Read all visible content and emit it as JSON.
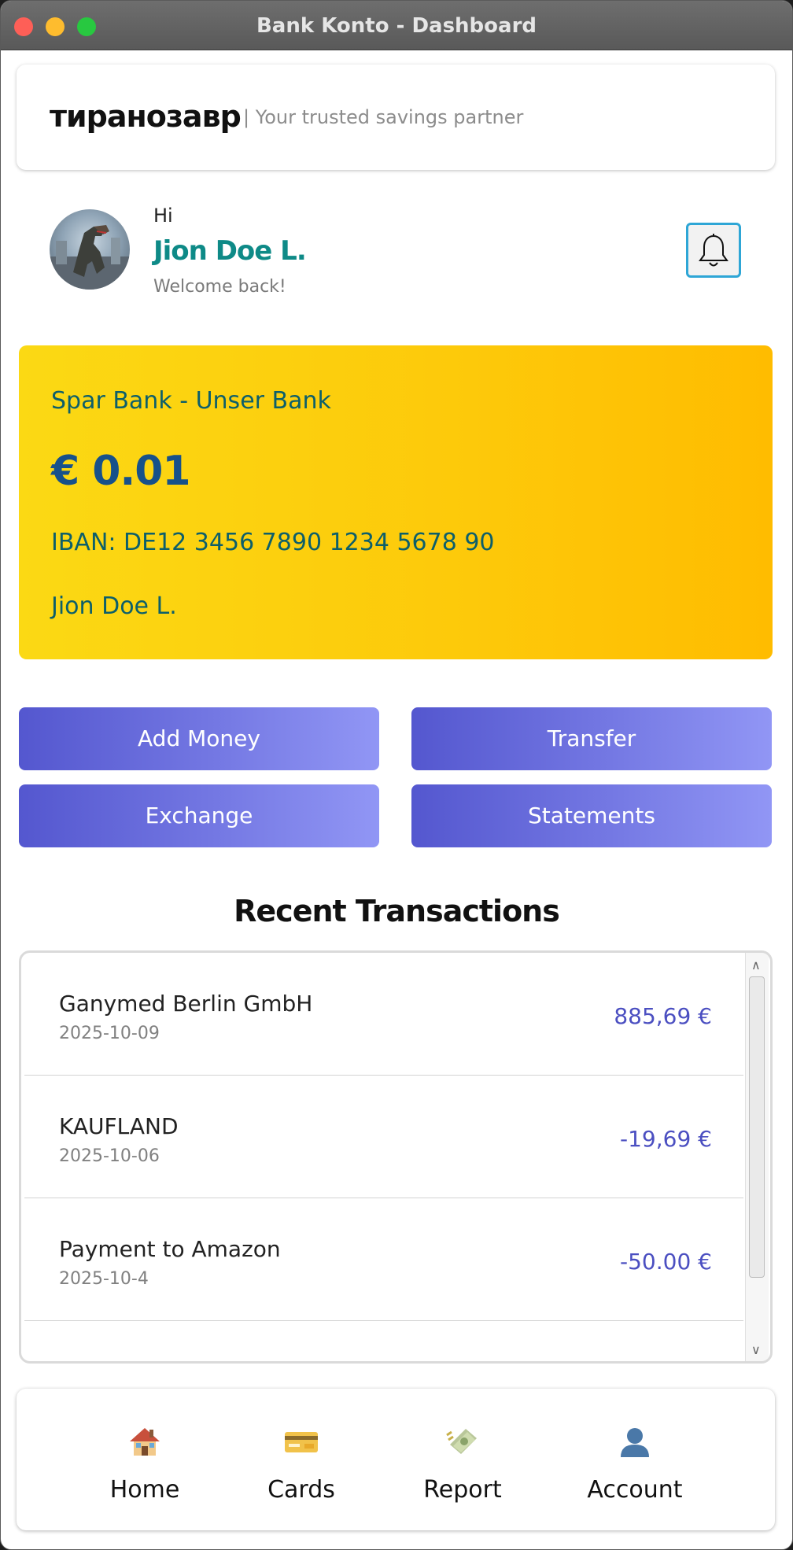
{
  "window": {
    "title": "Bank Konto - Dashboard"
  },
  "brand": {
    "name": "тиранозавр",
    "tagline": "| Your trusted savings partner"
  },
  "greeting": {
    "hi": "Hi",
    "name": "Jion Doe L.",
    "subtitle": "Welcome back!"
  },
  "account": {
    "bank": "Spar Bank - Unser Bank",
    "balance": "€ 0.01",
    "iban": "IBAN: DE12 3456 7890 1234 5678 90",
    "holder": "Jion Doe L."
  },
  "actions": [
    "Add Money",
    "Transfer",
    "Exchange",
    "Statements"
  ],
  "transactions_title": "Recent Transactions",
  "transactions": [
    {
      "name": "Ganymed Berlin GmbH",
      "date": "2025-10-09",
      "amount": "885,69  €"
    },
    {
      "name": "KAUFLAND",
      "date": "2025-10-06",
      "amount": "-19,69 €"
    },
    {
      "name": "Payment to Amazon",
      "date": "2025-10-4",
      "amount": "-50.00 €"
    }
  ],
  "nav": [
    {
      "label": "Home",
      "icon": "house-icon"
    },
    {
      "label": "Cards",
      "icon": "credit-card-icon"
    },
    {
      "label": "Report",
      "icon": "money-icon"
    },
    {
      "label": "Account",
      "icon": "user-icon"
    }
  ],
  "colors": {
    "accent_teal": "#0e8a87",
    "card_yellow": "#fbd914",
    "button_indigo": "#5457cf",
    "amount_indigo": "#4b4fc1"
  }
}
